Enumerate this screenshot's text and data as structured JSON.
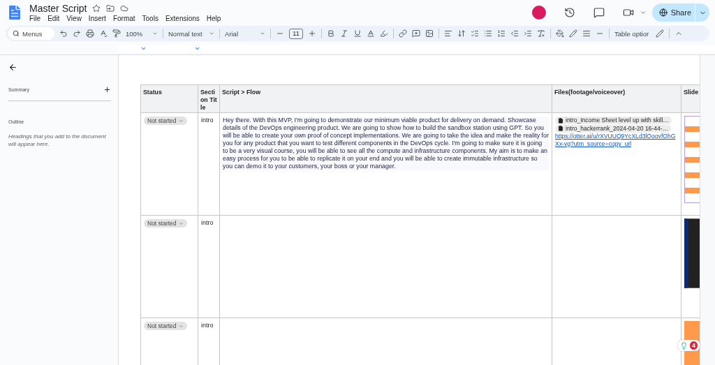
{
  "document": {
    "title": "Master Script"
  },
  "menus": [
    "File",
    "Edit",
    "View",
    "Insert",
    "Format",
    "Tools",
    "Extensions",
    "Help"
  ],
  "share": {
    "label": "Share"
  },
  "toolbar": {
    "search": "Menus",
    "zoom": "100%",
    "style": "Normal text",
    "font": "Arial",
    "font_size": "11",
    "table_options": "Table optior"
  },
  "sidebar": {
    "summary": "Summary",
    "outline": "Outline",
    "outline_hint": "Headings that you add to the document will appear here."
  },
  "table": {
    "columns": [
      "Status",
      "Secti on Title",
      "Script > Flow",
      "Files(footage/voiceover)",
      "Slide"
    ],
    "rows": [
      {
        "status": "Not started",
        "section": "intro",
        "script": "Hey there. With this MVP, I'm going to demonstrate our minimum viable product for delivery on demand. Showcase details of the DevOps engineering product. We are going to show how to build the sandbox station using GPT. So you will be able to create your own proof of concept implementations. We are going to take the idea and make the reality for you for any product that you want to test different components in the DevOps cycle. I'm going to make sure it is going to be a very visual course, you will be able to see all the compute and infrastructure components. My aim is to make an easy process for you to be able to replicate it on your end and you will be able to create immutable infrastructure so you can demo it to your customers, your boss or your manager.",
        "files": [
          "intro_Income Sheet level up with skill…",
          "intro_hackerrank_2024-04-20 16-44-…"
        ],
        "link": "https://otter.ai/u/rXVUUQ9YcXLd3lOoovfOhGXx-vg?utm_source=copy_url",
        "kind": "diagram"
      },
      {
        "status": "Not started",
        "section": "intro",
        "kind": "dark"
      },
      {
        "status": "Not started",
        "section": "intro",
        "kind": "orange"
      }
    ]
  },
  "extension": {
    "count": "4"
  }
}
